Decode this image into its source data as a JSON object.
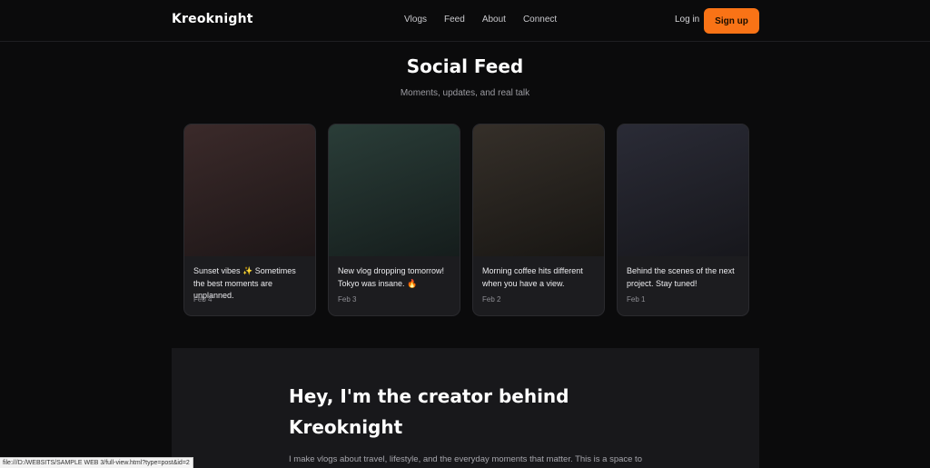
{
  "header": {
    "logo": "Kreoknight",
    "nav": [
      "Vlogs",
      "Feed",
      "About",
      "Connect"
    ],
    "login_label": "Log in",
    "signup_label": "Sign up",
    "accent_color": "#f97316"
  },
  "feed": {
    "title": "Social Feed",
    "subtitle": "Moments, updates, and real talk",
    "posts": [
      {
        "caption": "Sunset vibes ✨ Sometimes the best moments are unplanned.",
        "date": "Feb 4",
        "gradient": [
          "#3b2a2a",
          "#1d1617"
        ]
      },
      {
        "caption": "New vlog dropping tomorrow! Tokyo was insane. 🔥",
        "date": "Feb 3",
        "gradient": [
          "#2a3d38",
          "#151d1c"
        ]
      },
      {
        "caption": "Morning coffee hits different when you have a view.",
        "date": "Feb 2",
        "gradient": [
          "#352f29",
          "#181613"
        ]
      },
      {
        "caption": "Behind the scenes of the next project. Stay tuned!",
        "date": "Feb 1",
        "gradient": [
          "#2a2b36",
          "#17171c"
        ]
      }
    ]
  },
  "about": {
    "heading": "Hey, I'm the creator behind Kreoknight",
    "text": "I make vlogs about travel, lifestyle, and the everyday moments that matter. This is a space to"
  },
  "statusbar": {
    "url": "file:///D:/WEBSITS/SAMPLE WEB 3/full-view.html?type=post&id=2"
  }
}
